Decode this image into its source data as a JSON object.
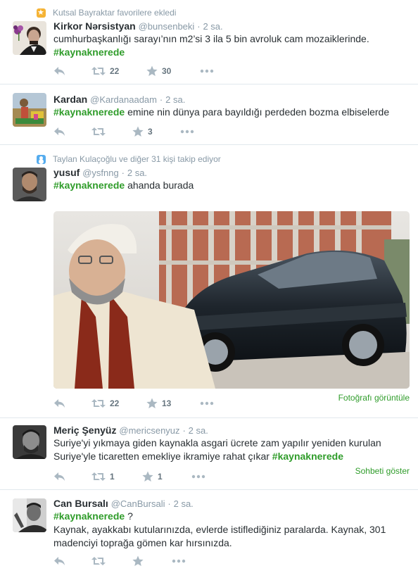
{
  "tweets": [
    {
      "context": "Kutsal Bayraktar favorilere ekledi",
      "fullname": "Kirkor Nərsistyan",
      "handle": "@bunsenbeki",
      "time": "2 sa.",
      "text": "cumhurbaşkanlığı sarayı’nın m2’si 3 ila 5 bin avroluk cam mozaiklerinde.",
      "hashtag": "#kaynaknerede",
      "retweets": "22",
      "favorites": "30"
    },
    {
      "fullname": "Kardan",
      "handle": "@Kardanaadam",
      "time": "2 sa.",
      "hashtag": "#kaynaknerede",
      "text": " emine nin dünya para bayıldığı perdeden bozma elbiselerde",
      "favorites": "3"
    },
    {
      "context": "Taylan Kulaçoğlu ve diğer 31 kişi takip ediyor",
      "fullname": "yusuf",
      "handle": "@ysfnng",
      "time": "2 sa.",
      "hashtag": "#kaynaknerede",
      "text": " ahanda burada",
      "retweets": "22",
      "favorites": "13",
      "link": "Fotoğrafı görüntüle"
    },
    {
      "fullname": "Meriç Şenyüz",
      "handle": "@mericsenyuz",
      "time": "2 sa.",
      "text_line1": "Suriye'yi yıkmaya giden kaynakla asgari ücrete zam yapılır yeniden kurulan",
      "text_line2": "Suriye'yle ticaretten emekliye ikramiye rahat çıkar ",
      "hashtag": "#kaynaknerede",
      "retweets": "1",
      "favorites": "1",
      "link": "Sohbeti göster"
    },
    {
      "fullname": "Can Bursalı",
      "handle": "@CanBursali",
      "time": "2 sa.",
      "hashtag": "#kaynaknerede",
      "hashtag_suffix": " ?",
      "text_line2": "Kaynak, ayakkabı kutularınızda, evlerde istiflediğiniz paralarda. Kaynak, 301",
      "text_line3": "madenciyi toprağa gömen kar hırsınızda."
    }
  ],
  "separator": "·",
  "colors": {
    "hashtag": "#2f9c2a",
    "muted": "#8899a6",
    "action": "#aab8c2"
  }
}
